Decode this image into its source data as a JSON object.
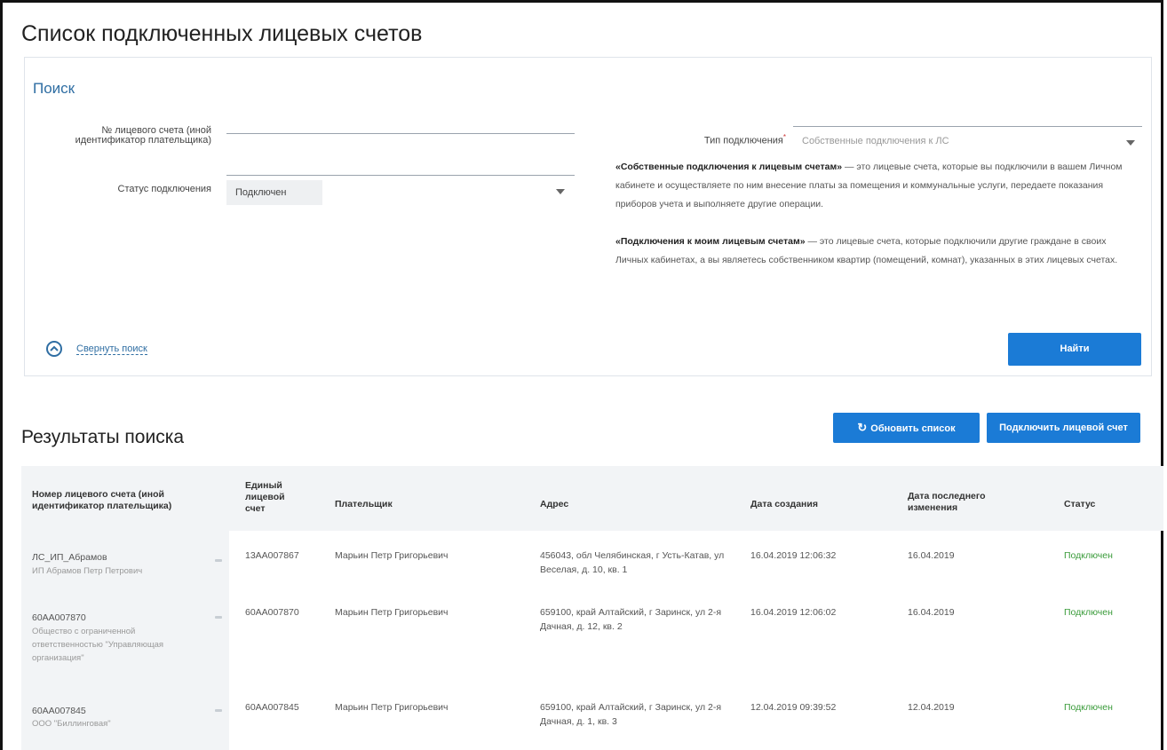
{
  "page_title": "Список подключенных лицевых счетов",
  "search": {
    "title": "Поиск",
    "account_label": "№ лицевого счета (иной идентификатор плательщика)",
    "account_value": "",
    "status_label": "Статус подключения",
    "status_value": "Подключен",
    "type_label": "Тип подключения",
    "type_required_mark": "*",
    "type_value": "Собственные подключения к ЛС",
    "info_p1_bold": "«Собственные подключения к лицевым счетам»",
    "info_p1_rest": " — это лицевые счета, которые вы подключили в вашем Личном кабинете и осуществляете по ним внесение платы за помещения и коммунальные услуги, передаете показания приборов учета и выполняете другие операции.",
    "info_p2_bold": "«Подключения к моим лицевым счетам»",
    "info_p2_rest": " — это лицевые счета, которые подключили другие граждане в своих Личных кабинетах, а вы являетесь собственником квартир (помещений, комнат), указанных в этих лицевых счетах.",
    "collapse_label": "Свернуть поиск",
    "find_button": "Найти"
  },
  "results": {
    "title": "Результаты поиска",
    "refresh_button": "Обновить список",
    "connect_button": "Подключить лицевой счет",
    "columns": [
      "Номер лицевого счета (иной идентификатор плательщика)",
      "Единый лицевой счет",
      "Плательщик",
      "Адрес",
      "Дата создания",
      "Дата последнего изменения",
      "Статус"
    ],
    "rows": [
      {
        "account": "ЛС_ИП_Абрамов",
        "account_sub": "ИП Абрамов Петр Петрович",
        "unified": "13АА007867",
        "payer": "Марьин Петр Григорьевич",
        "address": "456043, обл Челябинская, г Усть-Катав, ул Веселая, д. 10, кв. 1",
        "created": "16.04.2019 12:06:32",
        "modified": "16.04.2019",
        "status": "Подключен"
      },
      {
        "account": "60АА007870",
        "account_sub": "Общество с ограниченной ответственностью \"Управляющая организация\"",
        "unified": "60АА007870",
        "payer": "Марьин Петр Григорьевич",
        "address": "659100, край Алтайский, г Заринск, ул 2-я Дачная, д. 12, кв. 2",
        "created": "16.04.2019 12:06:02",
        "modified": "16.04.2019",
        "status": "Подключен"
      },
      {
        "account": "60АА007845",
        "account_sub": "ООО \"Биллинговая\"",
        "unified": "60АА007845",
        "payer": "Марьин Петр Григорьевич",
        "address": "659100, край Алтайский, г Заринск, ул 2-я Дачная, д. 1, кв. 3",
        "created": "12.04.2019 09:39:52",
        "modified": "12.04.2019",
        "status": "Подключен"
      }
    ]
  },
  "colors": {
    "accent": "#1b7bd6",
    "link": "#2f6ea3",
    "status_ok": "#3a9b3a"
  }
}
